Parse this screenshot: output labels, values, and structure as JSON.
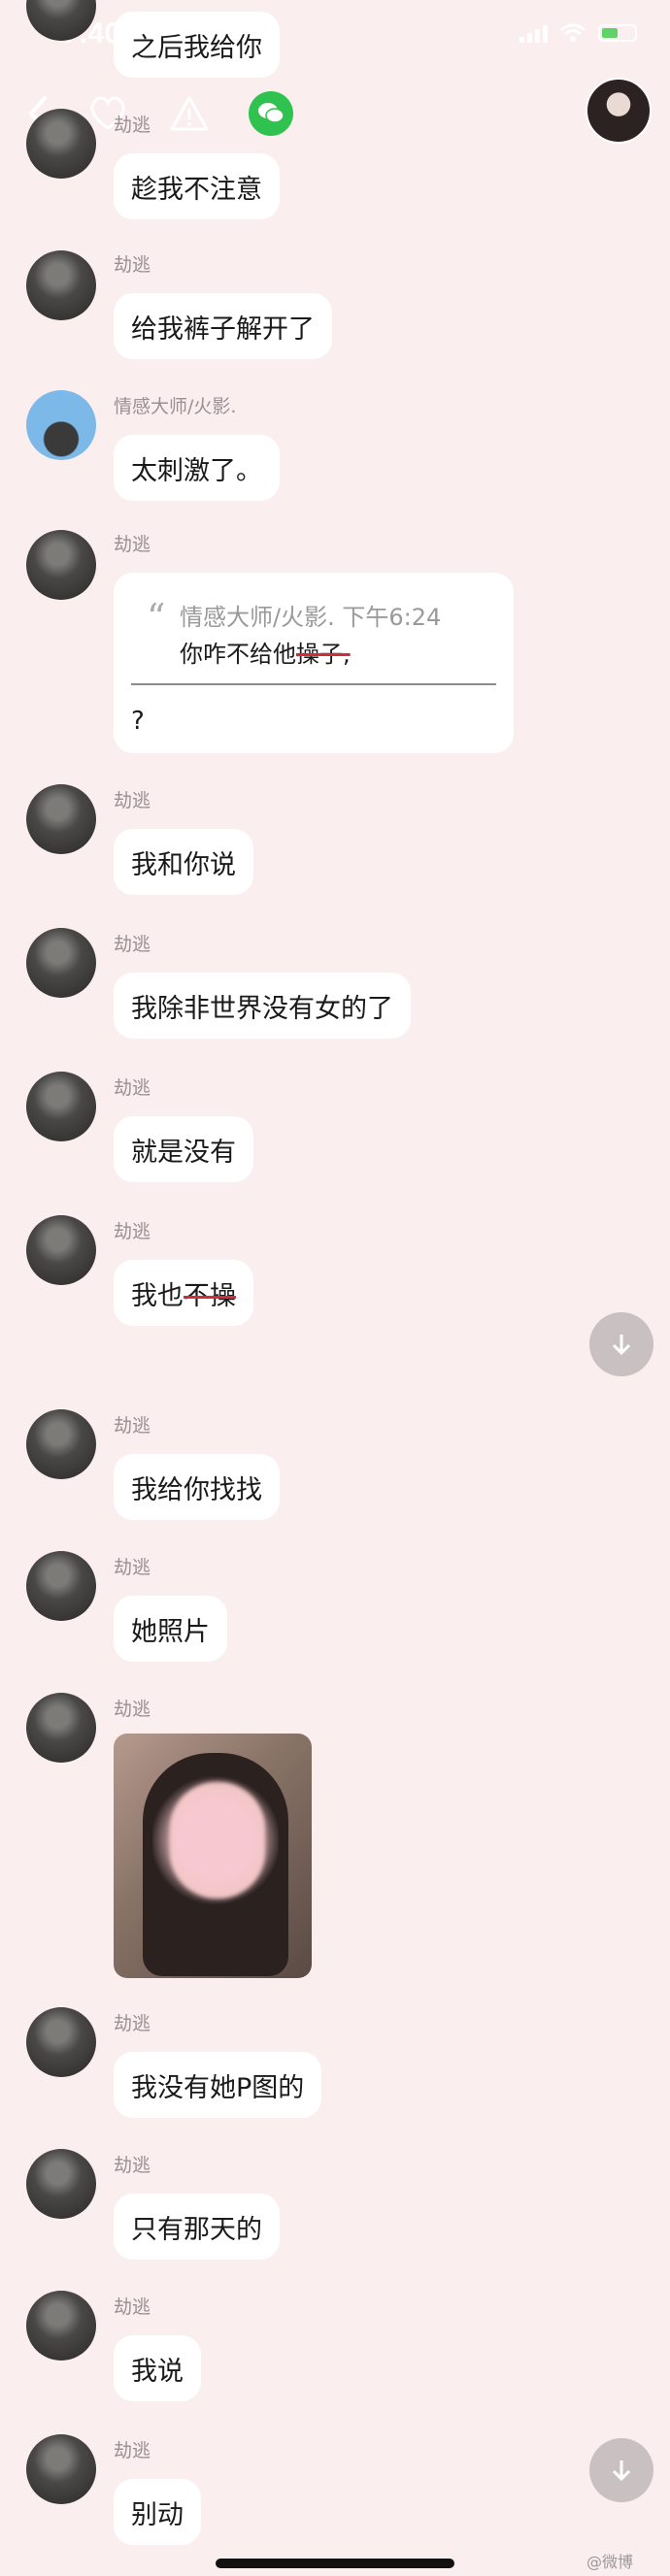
{
  "status": {
    "time": "7:40"
  },
  "partial_bubble": "之后我给你",
  "messages": [
    {
      "name": "劫逃",
      "text": "趁我不注意"
    },
    {
      "name": "劫逃",
      "text": "给我裤子解开了"
    },
    {
      "name": "情感大师/火影.",
      "text": "太刺激了。"
    },
    {
      "name": "劫逃",
      "quote": {
        "header": "情感大师/火影. 下午6:24",
        "text_plain": "你咋不给他",
        "text_struck": "操子,",
        "answer": "?"
      }
    },
    {
      "name": "劫逃",
      "text": "我和你说"
    },
    {
      "name": "劫逃",
      "text": "我除非世界没有女的了"
    },
    {
      "name": "劫逃",
      "text": "就是没有"
    },
    {
      "name": "劫逃",
      "text_plain": "我也",
      "text_struck": "不操"
    },
    {
      "name": "劫逃",
      "text": "我给你找找"
    },
    {
      "name": "劫逃",
      "text": "她照片"
    },
    {
      "name": "劫逃",
      "image": "photo"
    },
    {
      "name": "劫逃",
      "text": "我没有她P图的"
    },
    {
      "name": "劫逃",
      "text": "只有那天的"
    },
    {
      "name": "劫逃",
      "text": "我说"
    },
    {
      "name": "劫逃",
      "text": "别动"
    }
  ],
  "watermark": "@微博",
  "colors": {
    "background": "#fbeeee",
    "bubble": "#ffffff",
    "wechat": "#2fc24f",
    "strike": "#d62a3a"
  },
  "icons": [
    "back-icon",
    "heart-icon",
    "warning-icon",
    "wechat-icon",
    "scroll-down-icon"
  ]
}
